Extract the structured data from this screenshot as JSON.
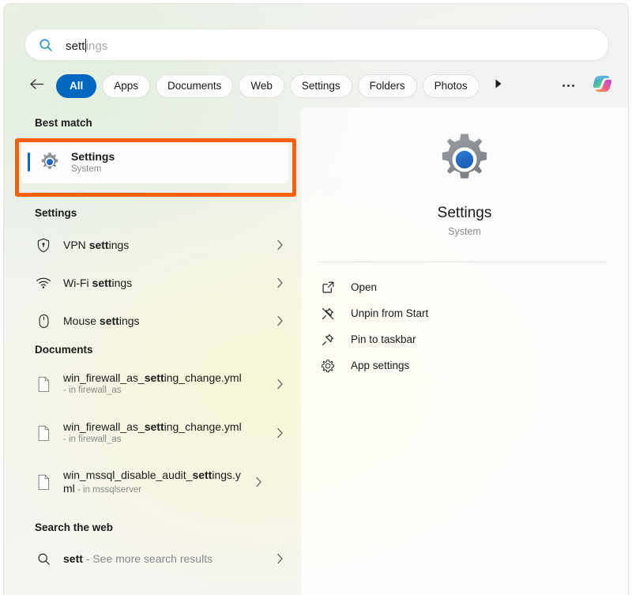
{
  "search": {
    "typed": "sett",
    "ghost": "ings",
    "full_value": "settings",
    "icon": "search-icon"
  },
  "filters": {
    "back_icon": "back-arrow-icon",
    "chips": [
      {
        "label": "All",
        "active": true
      },
      {
        "label": "Apps",
        "active": false
      },
      {
        "label": "Documents",
        "active": false
      },
      {
        "label": "Web",
        "active": false
      },
      {
        "label": "Settings",
        "active": false
      },
      {
        "label": "Folders",
        "active": false
      },
      {
        "label": "Photos",
        "active": false
      }
    ],
    "more_icon": "play-arrow-icon",
    "overflow_icon": "ellipsis-icon",
    "copilot_icon": "copilot-icon"
  },
  "results": {
    "best_match": {
      "header": "Best match",
      "title": "Settings",
      "subtitle": "System",
      "icon": "settings-gear-icon"
    },
    "settings_section": {
      "header": "Settings",
      "items": [
        {
          "prefix": "VPN ",
          "match": "sett",
          "suffix": "ings",
          "icon": "shield-icon"
        },
        {
          "prefix": "Wi-Fi ",
          "match": "sett",
          "suffix": "ings",
          "icon": "wifi-icon"
        },
        {
          "prefix": "Mouse ",
          "match": "sett",
          "suffix": "ings",
          "icon": "mouse-icon"
        }
      ]
    },
    "documents_section": {
      "header": "Documents",
      "items": [
        {
          "prefix": "win_firewall_as_",
          "match": "sett",
          "suffix": "ing_change.yml",
          "subtitle": "- in firewall_as",
          "icon": "document-icon",
          "wraps": false
        },
        {
          "prefix": "win_firewall_as_",
          "match": "sett",
          "suffix": "ing_change.yml",
          "subtitle": "- in firewall_as",
          "icon": "document-icon",
          "wraps": false
        },
        {
          "prefix": "win_mssql_disable_audit_",
          "match": "sett",
          "suffix": "ings.yml",
          "subtitle": "- in mssqlserver",
          "icon": "document-icon",
          "wraps": true
        }
      ]
    },
    "web_section": {
      "header": "Search the web",
      "item": {
        "match": "sett",
        "suffix": " - See more search results",
        "icon": "search-icon"
      }
    }
  },
  "preview": {
    "app_icon": "settings-gear-icon",
    "title": "Settings",
    "subtitle": "System",
    "actions": [
      {
        "label": "Open",
        "icon": "open-external-icon"
      },
      {
        "label": "Unpin from Start",
        "icon": "unpin-icon"
      },
      {
        "label": "Pin to taskbar",
        "icon": "pin-icon"
      },
      {
        "label": "App settings",
        "icon": "gear-outline-icon"
      }
    ]
  },
  "annotation": {
    "color": "#f4610a",
    "target": "best-match-settings-row"
  },
  "colors": {
    "accent": "#0067c0",
    "annotation": "#f4610a",
    "window_bg": "#f3f3f3",
    "muted_text": "#8a8a8a"
  }
}
